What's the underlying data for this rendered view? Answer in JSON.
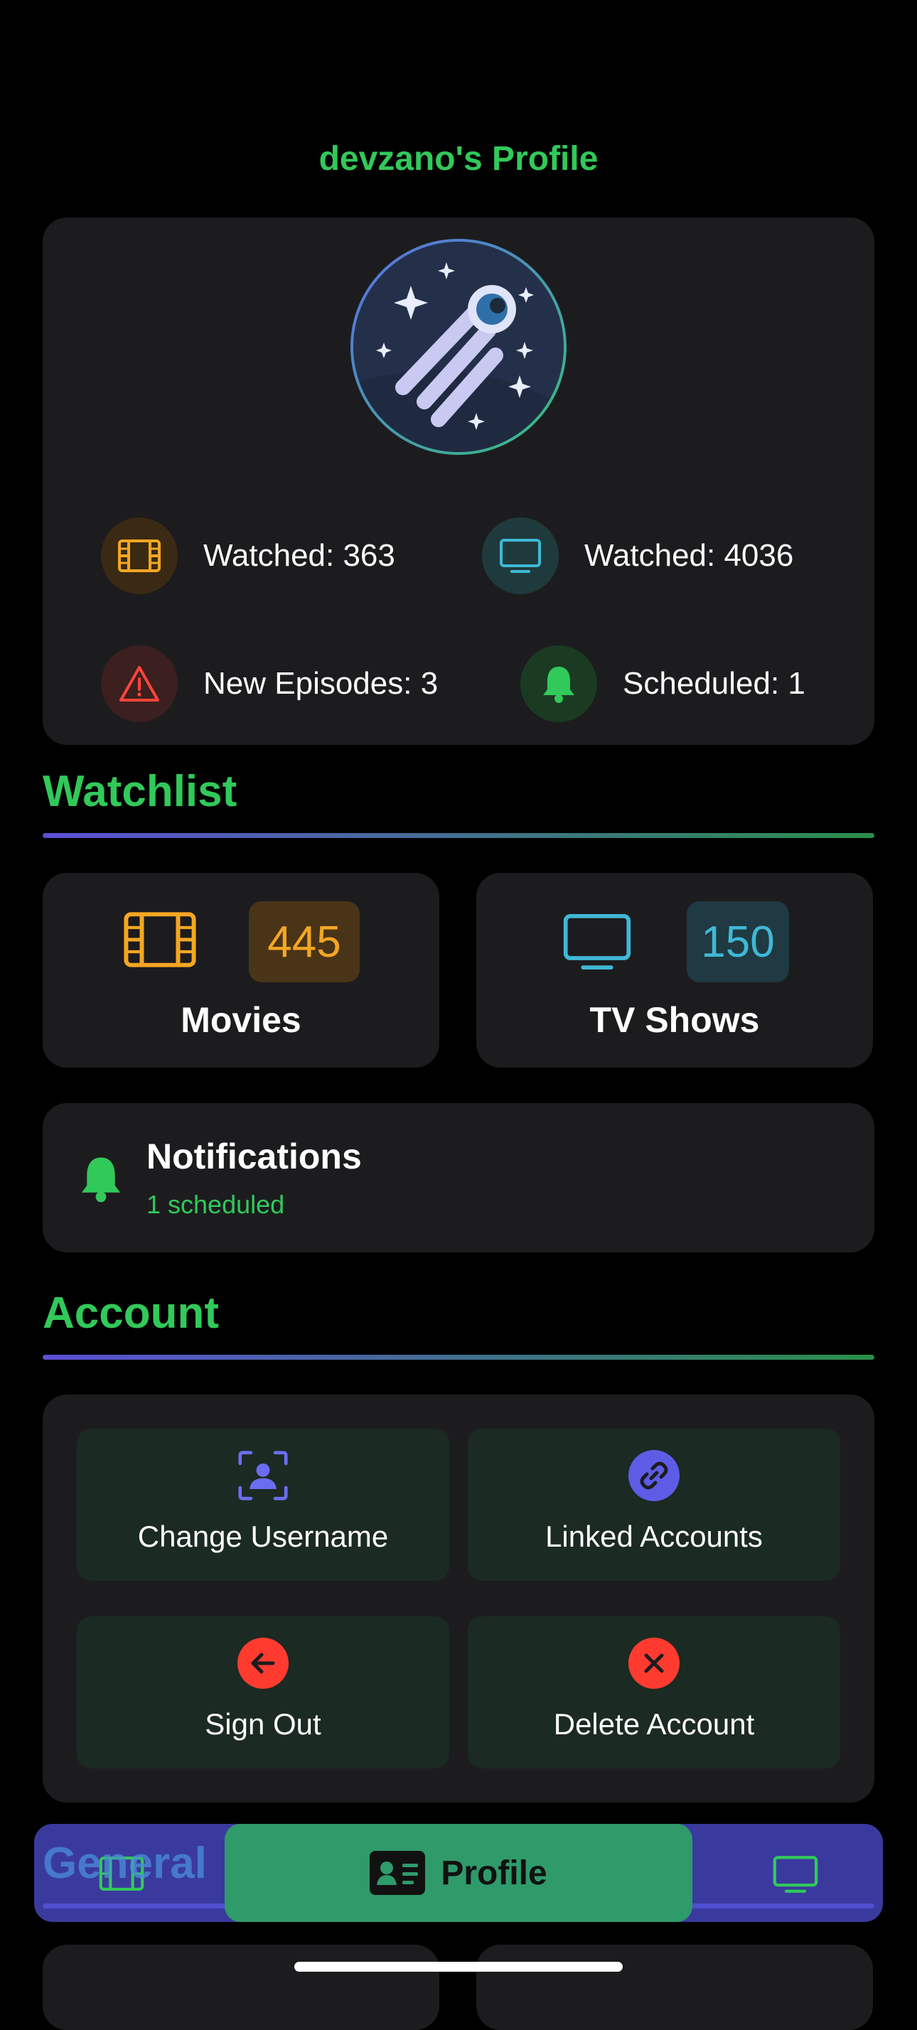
{
  "header": {
    "title": "devzano's Profile"
  },
  "stats": {
    "movies_watched": "Watched: 363",
    "shows_watched": "Watched: 4036",
    "new_episodes": "New Episodes: 3",
    "scheduled": "Scheduled: 1"
  },
  "watchlist": {
    "heading": "Watchlist",
    "movies": {
      "label": "Movies",
      "count": "445"
    },
    "tv_shows": {
      "label": "TV Shows",
      "count": "150"
    }
  },
  "notifications": {
    "title": "Notifications",
    "subtitle": "1 scheduled"
  },
  "account": {
    "heading": "Account",
    "buttons": {
      "change_username": "Change Username",
      "linked_accounts": "Linked Accounts",
      "sign_out": "Sign Out",
      "delete_account": "Delete Account"
    }
  },
  "general": {
    "heading": "General"
  },
  "tabbar": {
    "active_label": "Profile"
  },
  "colors": {
    "accent_green": "#31c95a",
    "movies_orange": "#f5a623",
    "tv_cyan": "#3fb8d6",
    "danger_red": "#ff3b30",
    "indigo": "#5e5ce6"
  }
}
